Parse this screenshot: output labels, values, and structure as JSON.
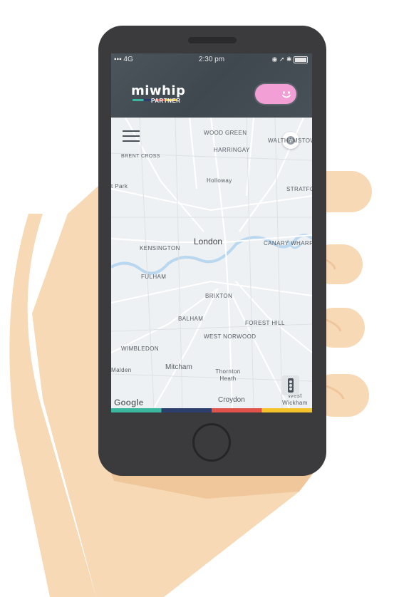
{
  "status_bar": {
    "signal": "4G",
    "time": "2:30 pm"
  },
  "header": {
    "logo": "miwhip",
    "subtitle": "PARTNER",
    "toggle_icon": "smiley-face-icon"
  },
  "map": {
    "city": "London",
    "attribution": "Google",
    "labels": {
      "wood_green": "WOOD GREEN",
      "walthamstow": "WALTHAMSTOW",
      "harringay": "HARRINGAY",
      "brent_cross": "BRENT CROSS",
      "holloway": "Holloway",
      "park": "t Park",
      "stratford": "STRATFOR",
      "kensington": "KENSINGTON",
      "canary_wharf": "CANARY WHARF",
      "fulham": "FULHAM",
      "brixton": "BRIXTON",
      "balham": "BALHAM",
      "forest_hill": "FOREST HILL",
      "west_norwood": "WEST NORWOOD",
      "wimbledon": "WIMBLEDON",
      "malden": "Malden",
      "mitcham": "Mitcham",
      "thornton_heath": "Thornton Heath",
      "croydon": "Croydon",
      "west_wickham": "West Wickham"
    }
  },
  "colors": {
    "teal": "#3bb7a0",
    "navy": "#2c3e6b",
    "red": "#e0524a",
    "yellow": "#f4c22b",
    "toggle": "#f29fd5"
  }
}
